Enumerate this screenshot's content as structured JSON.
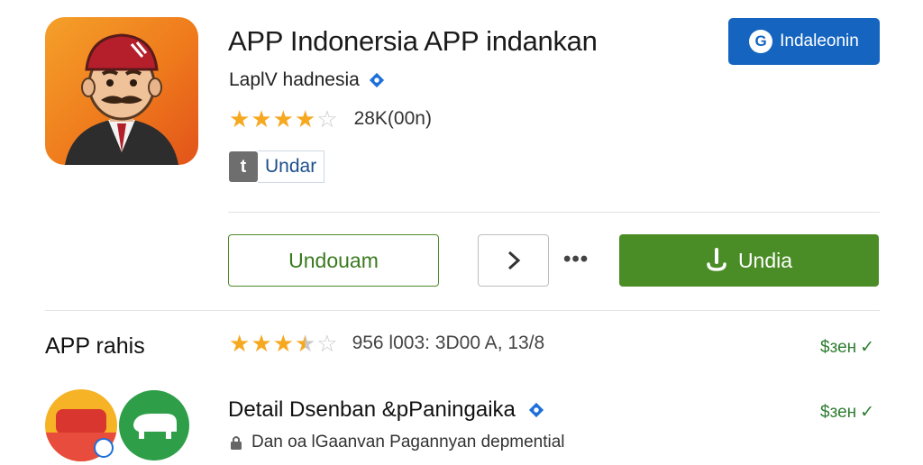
{
  "app": {
    "title": "APP Indonersia APP indankan",
    "developer": "LaplV hadnesia",
    "rating_count": "28K​(00n)",
    "badge_label": "Undar",
    "brand_button": "Indaleonin",
    "brand_logo": "G"
  },
  "actions": {
    "secondary_label": "Undouam",
    "more_label": "•••",
    "install_label": "Undia"
  },
  "section": {
    "title": "APP rahis",
    "rating_meta": "956 l003: 3D00 A, 13/8",
    "price": "$зен"
  },
  "detail": {
    "title": "Detail Dsenban &pPaningaika",
    "subtitle": "Dan oa lGaanvan Pagannyan depmential",
    "price": "$зен"
  },
  "colors": {
    "accent_green": "#4a8c25",
    "brand_blue": "#1565c0",
    "star": "#f6a821",
    "price_green": "#2e7d32"
  },
  "ratings": {
    "app_stars": 4,
    "section_stars": 3.5
  }
}
